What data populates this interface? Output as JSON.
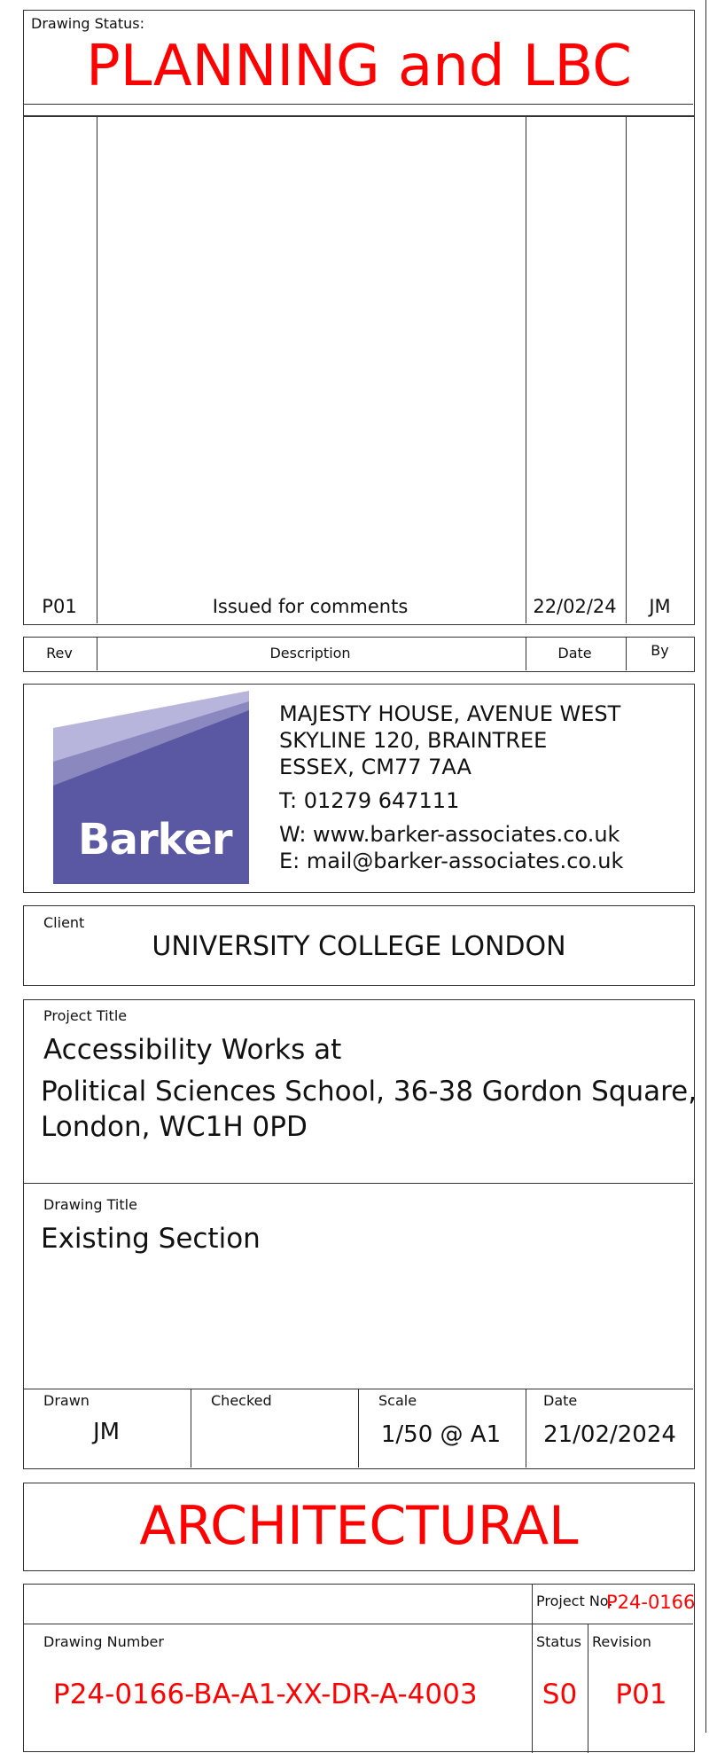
{
  "status": {
    "label": "Drawing Status:",
    "value": "PLANNING and LBC"
  },
  "revisions": {
    "rows": [
      {
        "rev": "P01",
        "description": "Issued for comments",
        "date": "22/02/24",
        "by": "JM"
      }
    ],
    "headers": {
      "rev": "Rev",
      "description": "Description",
      "date": "Date",
      "by": "By"
    }
  },
  "company": {
    "logo_text": "Barker",
    "address_lines": [
      "MAJESTY HOUSE, AVENUE WEST",
      "SKYLINE 120, BRAINTREE",
      "ESSEX, CM77 7AA"
    ],
    "phone": "T: 01279 647111",
    "web": "W: www.barker-associates.co.uk",
    "email": "E: mail@barker-associates.co.uk",
    "colors": {
      "logo_dark": "#5a57a3",
      "logo_mid": "#8b88c0",
      "logo_light": "#b7b5dc"
    }
  },
  "client": {
    "label": "Client",
    "value": "UNIVERSITY COLLEGE LONDON"
  },
  "project": {
    "label": "Project Title",
    "line1": "Accessibility Works at",
    "line2": "Political Sciences School, 36-38 Gordon Square,",
    "line3": "London, WC1H 0PD"
  },
  "drawing_title": {
    "label": "Drawing Title",
    "value": "Existing Section"
  },
  "meta": {
    "drawn_label": "Drawn",
    "drawn_value": "JM",
    "checked_label": "Checked",
    "checked_value": "",
    "scale_label": "Scale",
    "scale_value": "1/50 @ A1",
    "date_label": "Date",
    "date_value": "21/02/2024"
  },
  "discipline": "ARCHITECTURAL",
  "numbers": {
    "project_no_label": "Project No.",
    "project_no_value": "P24-0166",
    "drawing_number_label": "Drawing Number",
    "drawing_number_value": "P24-0166-BA-A1-XX-DR-A-4003",
    "status_label": "Status",
    "status_value": "S0",
    "revision_label": "Revision",
    "revision_value": "P01"
  }
}
